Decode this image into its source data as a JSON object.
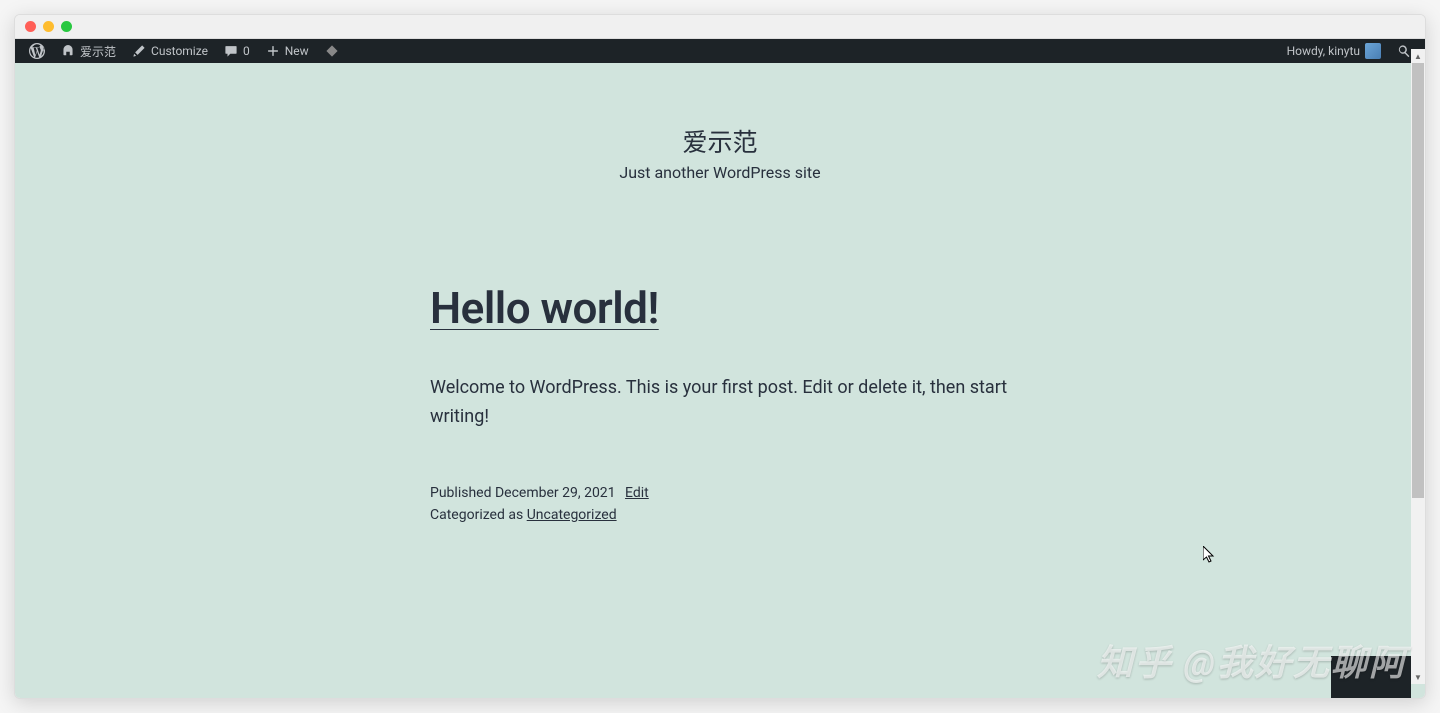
{
  "adminbar": {
    "site_name": "爱示范",
    "customize_label": "Customize",
    "comments_count": "0",
    "new_label": "New",
    "howdy_prefix": "Howdy, ",
    "username": "kinytu"
  },
  "site": {
    "title": "爱示范",
    "tagline": "Just another WordPress site"
  },
  "post": {
    "title": "Hello world!",
    "excerpt": "Welcome to WordPress. This is your first post. Edit or delete it, then start writing!",
    "published_label": "Published",
    "published_date": "December 29, 2021",
    "edit_label": "Edit",
    "categorized_label": "Categorized as",
    "category": "Uncategorized"
  },
  "watermark": "知乎 @我好无聊阿"
}
